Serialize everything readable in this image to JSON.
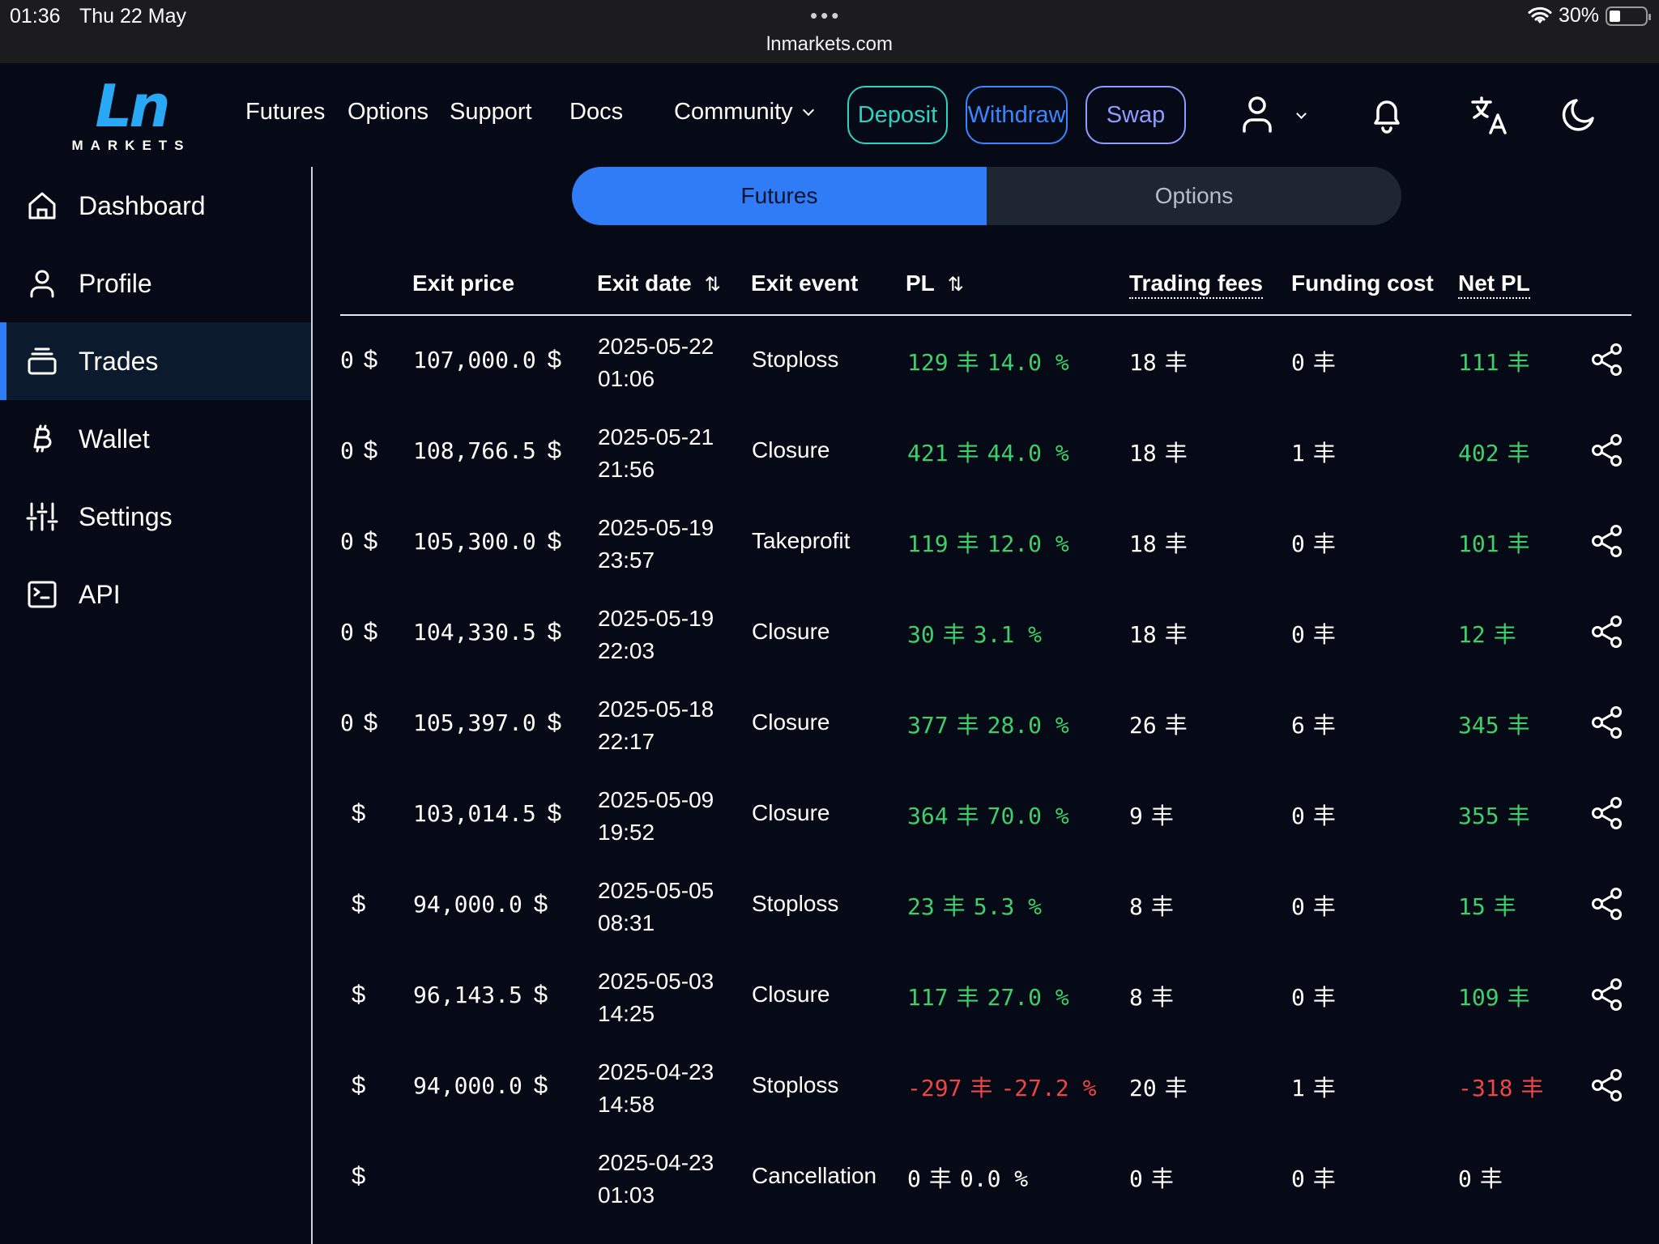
{
  "status_bar": {
    "time": "01:36",
    "date": "Thu 22 May",
    "url": "lnmarkets.com",
    "battery": "30%"
  },
  "logo": {
    "mark": "Ln",
    "sub": "MARKETS"
  },
  "nav": {
    "futures": "Futures",
    "options": "Options",
    "support": "Support",
    "docs": "Docs",
    "community": "Community",
    "deposit": "Deposit",
    "withdraw": "Withdraw",
    "swap": "Swap"
  },
  "sidebar": {
    "items": [
      {
        "label": "Dashboard",
        "icon": "home-icon"
      },
      {
        "label": "Profile",
        "icon": "user-icon"
      },
      {
        "label": "Trades",
        "icon": "stack-icon"
      },
      {
        "label": "Wallet",
        "icon": "bitcoin-icon"
      },
      {
        "label": "Settings",
        "icon": "sliders-icon"
      },
      {
        "label": "API",
        "icon": "terminal-icon"
      }
    ],
    "active": "Trades"
  },
  "segmented": {
    "futures": "Futures",
    "options": "Options",
    "active": "Futures"
  },
  "table": {
    "headers": {
      "exit_price": "Exit price",
      "exit_date": "Exit date",
      "exit_event": "Exit event",
      "pl": "PL",
      "trading_fees": "Trading fees",
      "funding_cost": "Funding cost",
      "net_pl": "Net PL"
    },
    "currency": "$",
    "sat_symbol": "丰",
    "percent": "%",
    "rows": [
      {
        "qty": "0",
        "exit_price": "107,000.0",
        "exit_date": "2025-05-22 01:06",
        "exit_event": "Stoploss",
        "pl": "129",
        "pl_pct": "14.0",
        "fees": "18",
        "funding": "0",
        "net": "111",
        "tone": "green"
      },
      {
        "qty": "0",
        "exit_price": "108,766.5",
        "exit_date": "2025-05-21 21:56",
        "exit_event": "Closure",
        "pl": "421",
        "pl_pct": "44.0",
        "fees": "18",
        "funding": "1",
        "net": "402",
        "tone": "green"
      },
      {
        "qty": "0",
        "exit_price": "105,300.0",
        "exit_date": "2025-05-19 23:57",
        "exit_event": "Takeprofit",
        "pl": "119",
        "pl_pct": "12.0",
        "fees": "18",
        "funding": "0",
        "net": "101",
        "tone": "green"
      },
      {
        "qty": "0",
        "exit_price": "104,330.5",
        "exit_date": "2025-05-19 22:03",
        "exit_event": "Closure",
        "pl": "30",
        "pl_pct": "3.1",
        "fees": "18",
        "funding": "0",
        "net": "12",
        "tone": "green"
      },
      {
        "qty": "0",
        "exit_price": "105,397.0",
        "exit_date": "2025-05-18 22:17",
        "exit_event": "Closure",
        "pl": "377",
        "pl_pct": "28.0",
        "fees": "26",
        "funding": "6",
        "net": "345",
        "tone": "green"
      },
      {
        "qty": "",
        "exit_price": "103,014.5",
        "exit_date": "2025-05-09 19:52",
        "exit_event": "Closure",
        "pl": "364",
        "pl_pct": "70.0",
        "fees": "9",
        "funding": "0",
        "net": "355",
        "tone": "green"
      },
      {
        "qty": "",
        "exit_price": "94,000.0",
        "exit_date": "2025-05-05 08:31",
        "exit_event": "Stoploss",
        "pl": "23",
        "pl_pct": "5.3",
        "fees": "8",
        "funding": "0",
        "net": "15",
        "tone": "green"
      },
      {
        "qty": "",
        "exit_price": "96,143.5",
        "exit_date": "2025-05-03 14:25",
        "exit_event": "Closure",
        "pl": "117",
        "pl_pct": "27.0",
        "fees": "8",
        "funding": "0",
        "net": "109",
        "tone": "green"
      },
      {
        "qty": "",
        "exit_price": "94,000.0",
        "exit_date": "2025-04-23 14:58",
        "exit_event": "Stoploss",
        "pl": "-297",
        "pl_pct": "-27.2",
        "fees": "20",
        "funding": "1",
        "net": "-318",
        "tone": "red"
      },
      {
        "qty": "",
        "exit_price": "",
        "exit_date": "2025-04-23 01:03",
        "exit_event": "Cancellation",
        "pl": "0",
        "pl_pct": "0.0",
        "fees": "0",
        "funding": "0",
        "net": "0",
        "tone": "white"
      }
    ]
  }
}
